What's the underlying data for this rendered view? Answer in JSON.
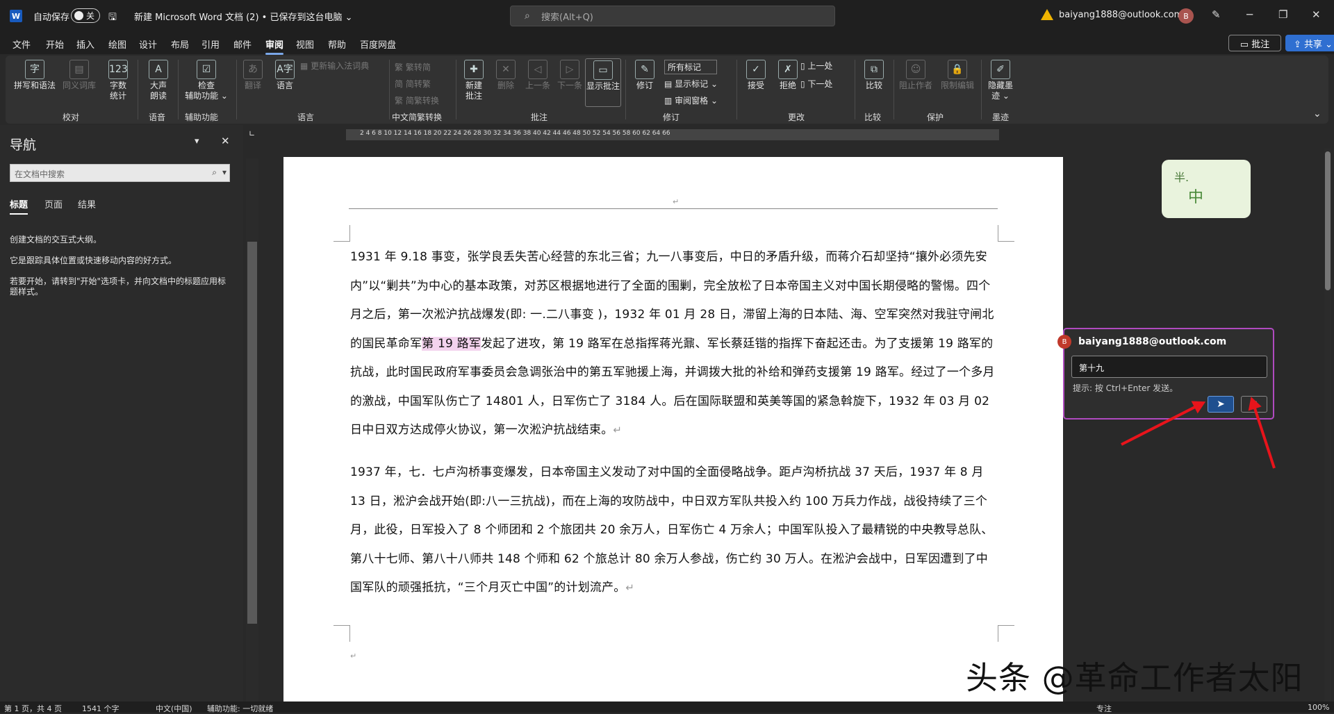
{
  "titlebar": {
    "autosave_label": "自动保存",
    "autosave_state": "关",
    "doc_title": "新建 Microsoft Word 文档 (2) • 已保存到这台电脑 ⌄",
    "search_placeholder": "搜索(Alt+Q)",
    "account": "baiyang1888@outlook.com",
    "avatar_initial": "B"
  },
  "menu": {
    "items": [
      "文件",
      "开始",
      "插入",
      "绘图",
      "设计",
      "布局",
      "引用",
      "邮件",
      "审阅",
      "视图",
      "帮助",
      "百度网盘"
    ],
    "active": "审阅",
    "comment_btn": "▭ 批注",
    "share_btn": "⇪ 共享 ⌄"
  },
  "ribbon": {
    "spell": "拼写和语法",
    "thesaurus": "同义词库",
    "wordcount": "字数\n统计",
    "proof_group": "校对",
    "readaloud": "大声\n朗读",
    "speech_group": "语音",
    "accessibility": "检查\n辅助功能 ⌄",
    "access_group": "辅助功能",
    "translate": "翻译",
    "language": "语言",
    "ime_update": "更新输入法词典",
    "lang_group": "语言",
    "t2s": "繁转简",
    "s2t": "简转繁",
    "conv": "简繁转换",
    "chinese_group": "中文简繁转换",
    "new_comment": "新建\n批注",
    "delete": "删除",
    "prev": "上一条",
    "next": "下一条",
    "show_comments": "显示批注",
    "comment_group": "批注",
    "track": "修订",
    "all_markup": "所有标记",
    "show_markup": "显示标记 ⌄",
    "review_pane": "审阅窗格 ⌄",
    "track_group": "修订",
    "accept": "接受",
    "reject": "拒绝",
    "prev_change": "上一处",
    "next_change": "下一处",
    "change_group": "更改",
    "compare": "比较",
    "compare_group": "比较",
    "block_authors": "阻止作者",
    "restrict": "限制编辑",
    "protect_group": "保护",
    "hide_ink": "隐藏墨\n迹 ⌄",
    "ink_group": "墨迹"
  },
  "nav": {
    "title": "导航",
    "search_placeholder": "在文档中搜索",
    "tabs": [
      "标题",
      "页面",
      "结果"
    ],
    "p1": "创建文档的交互式大纲。",
    "p2": "它是跟踪具体位置或快速移动内容的好方式。",
    "p3": "若要开始，请转到\"开始\"选项卡，并向文档中的标题应用标题样式。"
  },
  "ruler": {
    "marks": "2    4    6    8   10   12   14   16   18   20   22   24   26   28   30   32   34   36   38   40   42   44   46   48   50   52   54   56   58   60   62   64   66"
  },
  "document": {
    "para1_a": "1931 年 9.18 事变，张学良丢失苦心经营的东北三省；九一八事变后，中日的矛盾升级，而蒋介石却坚持“攘外必须先安内”以“剿共”为中心的基本政策，对苏区根据地进行了全面的围剿，完全放松了日本帝国主义对中国长期侵略的警惕。四个月之后，第一次淞沪抗战爆发(即: 一.二八事变 )，1932 年 01 月 28 日，滞留上海的日本陆、海、空军突然对我驻守闸北的国民革命军",
    "para1_hl": "第 19 路军",
    "para1_b": "发起了进攻，第 19 路军在总指挥蒋光鼐、军长蔡廷锴的指挥下奋起还击。为了支援第 19 路军的抗战，此时国民政府军事委员会急调张治中的第五军驰援上海，并调拨大批的补给和弹药支援第 19 路军。经过了一个多月的激战，中国军队伤亡了 14801 人，日军伤亡了 3184 人。后在国际联盟和英美等国的紧急斡旋下，1932 年 03 月 02 日中日双方达成停火协议，第一次淞沪抗战结束。",
    "para2": "1937 年，七．七卢沟桥事变爆发，日本帝国主义发动了对中国的全面侵略战争。距卢沟桥抗战 37 天后，1937 年 8 月 13 日，淞沪会战开始(即:八一三抗战)，而在上海的攻防战中，中日双方军队共投入约 100 万兵力作战，战役持续了三个月，此役，日军投入了 8 个师团和 2 个旅团共 20 余万人，日军伤亡 4 万余人；中国军队投入了最精锐的中央教导总队、第八十七师、第八十八师共 148 个师和 62 个旅总计 80 余万人参战，伤亡约 30 万人。在淞沪会战中，日军因遭到了中国军队的顽强抵抗，“三个月灭亡中国”的计划流产。",
    "para_mark": "↵"
  },
  "comment": {
    "author": "baiyang1888@outlook.com",
    "avatar_initial": "B",
    "input_value": "第十九",
    "hint": "提示: 按 Ctrl+Enter 发送。",
    "send_icon": "➤",
    "close_icon": "✕"
  },
  "sticker": {
    "line1": "半.",
    "line2": "中"
  },
  "status": {
    "page": "第 1 页，共 4 页",
    "words": "1541 个字",
    "lang": "中文(中国)",
    "accessibility": "辅助功能: 一切就绪",
    "focus": "专注",
    "zoom": "100%"
  },
  "watermark": "头条 @革命工作者太阳",
  "colors": {
    "accent": "#2f6fd1",
    "comment_border": "#b04ac0",
    "highlight": "#f3d3ee",
    "arrow": "#e8141b"
  }
}
